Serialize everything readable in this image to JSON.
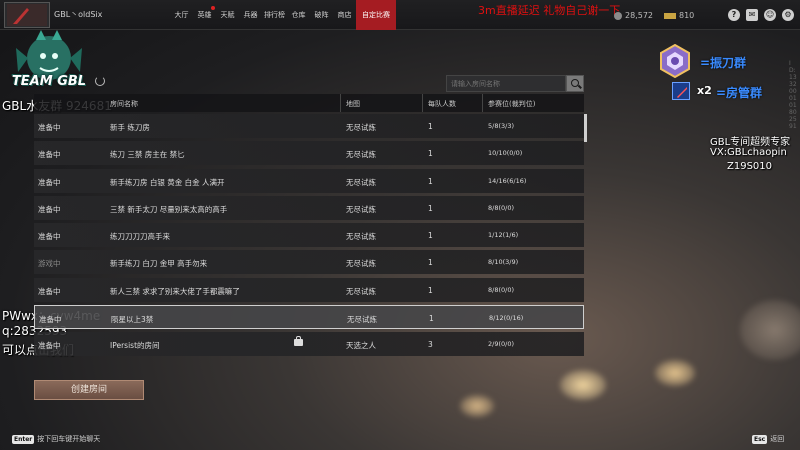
{
  "topbar": {
    "username": "GBL丶oldSix",
    "nav": [
      "大厅",
      "英雄",
      "天赋",
      "兵器",
      "排行榜",
      "仓库",
      "破阵",
      "商店",
      "自定比赛"
    ],
    "active_nav": "自定比赛",
    "stream_notice": "3m直播延迟 礼物自己谢一下",
    "currency_silver": "28,572",
    "currency_gold": "810",
    "icons": [
      "help-icon",
      "mail-icon",
      "friends-icon",
      "settings-icon"
    ]
  },
  "overlay": {
    "team_logo_text": "TEAM GBL",
    "group_text": "GBL水友群 924681",
    "wechat": "PWwx：cyw4me",
    "qq": "q:2832593",
    "click_me": "可以点击我们",
    "right_line1": "GBL专间超频专家",
    "right_line2": "VX:GBLchaopin",
    "right_line3": "Z19S010",
    "badge1_label": "=振刀群",
    "badge2_multiplier": "x2",
    "badge2_label": "=房管群",
    "side_vertical": "ID:1332000101802591"
  },
  "search": {
    "placeholder": "请输入房间名称"
  },
  "table": {
    "headers": {
      "status": "",
      "name": "房间名称",
      "map": "地图",
      "team": "每队人数",
      "count": "参赛位(裁判位)"
    },
    "rows": [
      {
        "status": "准备中",
        "name": "新手 练刀房",
        "map": "无尽试炼",
        "team": "1",
        "count": "5/8(3/3)"
      },
      {
        "status": "准备中",
        "name": "练刀 三禁 房主在 禁匕",
        "map": "无尽试炼",
        "team": "1",
        "count": "10/10(0/0)"
      },
      {
        "status": "准备中",
        "name": "新手练刀房 白银 黄金 白金 人满开",
        "map": "无尽试炼",
        "team": "1",
        "count": "14/16(6/16)"
      },
      {
        "status": "准备中",
        "name": "三禁 新手太刀  尽量别来太高的高手",
        "map": "无尽试炼",
        "team": "1",
        "count": "8/8(0/0)"
      },
      {
        "status": "准备中",
        "name": "练刀刀刀刀高手来",
        "map": "无尽试炼",
        "team": "1",
        "count": "1/12(1/6)"
      },
      {
        "status": "游戏中",
        "name": "新手练刀 白刀 金甲 高手勿来",
        "map": "无尽试炼",
        "team": "1",
        "count": "8/10(3/9)"
      },
      {
        "status": "准备中",
        "name": "新人三禁 求求了别来大佬了手都震嘛了",
        "map": "无尽试炼",
        "team": "1",
        "count": "8/8(0/0)"
      },
      {
        "status": "准备中",
        "name": "陨星以上3禁",
        "map": "无尽试炼",
        "team": "1",
        "count": "8/12(0/16)"
      },
      {
        "status": "准备中",
        "name": "IPersist的房间",
        "map": "天选之人",
        "team": "3",
        "count": "2/9(0/0)"
      }
    ]
  },
  "actions": {
    "create_room": "创建房间"
  },
  "hints": {
    "enter_key": "Enter",
    "enter_text": "按下回车键开始聊天",
    "esc_key": "Esc",
    "esc_text": "返回"
  }
}
